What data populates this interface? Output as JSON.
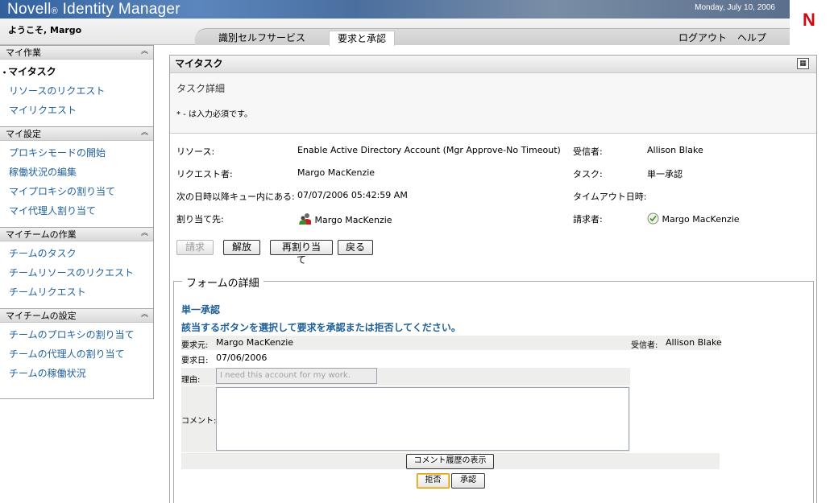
{
  "header": {
    "brand_main": "Novell",
    "brand_reg": "®",
    "brand_product": " Identity Manager",
    "date": "Monday, July 10, 2006",
    "logo": "N",
    "welcome": "ようこそ, Margo",
    "tabs": [
      {
        "label": "識別セルフサービス"
      },
      {
        "label": "要求と承認"
      }
    ],
    "logout": "ログアウト",
    "help": "ヘルプ"
  },
  "sidebar": {
    "sections": [
      {
        "title": "マイ作業",
        "items": [
          "マイタスク",
          "リソースのリクエスト",
          "マイリクエスト"
        ]
      },
      {
        "title": "マイ設定",
        "items": [
          "プロキシモードの開始",
          "稼働状況の編集",
          "マイプロキシの割り当て",
          "マイ代理人割り当て"
        ]
      },
      {
        "title": "マイチームの作業",
        "items": [
          "チームのタスク",
          "チームリソースのリクエスト",
          "チームリクエスト"
        ]
      },
      {
        "title": "マイチームの設定",
        "items": [
          "チームのプロキシの割り当て",
          "チームの代理人の割り当て",
          "チームの稼働状況"
        ]
      }
    ],
    "collapse_icon": "double-chevron-up-icon"
  },
  "panel": {
    "title": "マイタスク",
    "detail_title": "タスク詳細",
    "required_note": "* - は入力必須です。",
    "resource_label": "リソース:",
    "resource_value": "Enable Active Directory Account (Mgr Approve-No Timeout)",
    "recipient_label": "受信者:",
    "recipient_value": "Allison Blake",
    "requester_label": "リクエスト者:",
    "requester_value": "Margo MacKenzie",
    "task_label": "タスク:",
    "task_value": "単一承認",
    "queue_label": "次の日時以降キュー内にある:",
    "queue_value": "07/07/2006 05:42:59 AM",
    "timeout_label": "タイムアウト日時:",
    "timeout_value": "",
    "assigned_label": "割り当て先:",
    "assigned_value": "Margo MacKenzie",
    "claimant_label": "請求者:",
    "claimant_value": "Margo MacKenzie",
    "buttons": {
      "claim": "請求",
      "release": "解放",
      "reassign": "再割り当て",
      "back": "戻る"
    }
  },
  "form": {
    "legend": "フォームの詳細",
    "heading": "単一承認",
    "instruction": "該当するボタンを選択して要求を承認または拒否してください。",
    "from_label": "要求元:",
    "from_value": "Margo MacKenzie",
    "recipient_label": "受信者:",
    "recipient_value": "Allison Blake",
    "date_label": "要求日:",
    "date_value": "07/06/2006",
    "reason_label": "理由:",
    "reason_value": "I need this account for my work.",
    "comment_label": "コメント:",
    "comment_value": "",
    "history_button": "コメント履歴の表示",
    "deny_button": "拒否",
    "approve_button": "承認"
  }
}
